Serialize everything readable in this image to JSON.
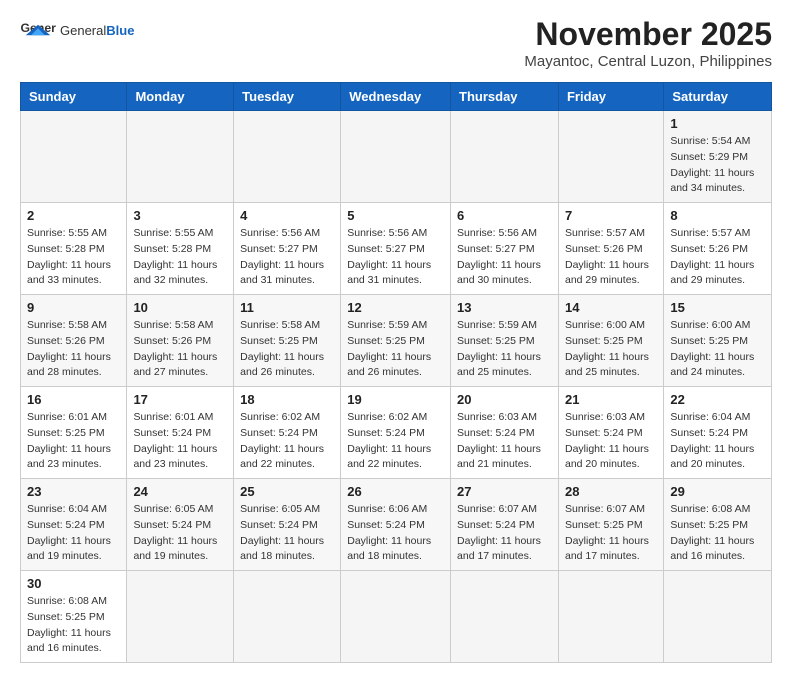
{
  "header": {
    "logo_general": "General",
    "logo_blue": "Blue",
    "month": "November 2025",
    "location": "Mayantoc, Central Luzon, Philippines"
  },
  "weekdays": [
    "Sunday",
    "Monday",
    "Tuesday",
    "Wednesday",
    "Thursday",
    "Friday",
    "Saturday"
  ],
  "rows": [
    [
      {
        "day": "",
        "info": ""
      },
      {
        "day": "",
        "info": ""
      },
      {
        "day": "",
        "info": ""
      },
      {
        "day": "",
        "info": ""
      },
      {
        "day": "",
        "info": ""
      },
      {
        "day": "",
        "info": ""
      },
      {
        "day": "1",
        "info": "Sunrise: 5:54 AM\nSunset: 5:29 PM\nDaylight: 11 hours and 34 minutes."
      }
    ],
    [
      {
        "day": "2",
        "info": "Sunrise: 5:55 AM\nSunset: 5:28 PM\nDaylight: 11 hours and 33 minutes."
      },
      {
        "day": "3",
        "info": "Sunrise: 5:55 AM\nSunset: 5:28 PM\nDaylight: 11 hours and 32 minutes."
      },
      {
        "day": "4",
        "info": "Sunrise: 5:56 AM\nSunset: 5:27 PM\nDaylight: 11 hours and 31 minutes."
      },
      {
        "day": "5",
        "info": "Sunrise: 5:56 AM\nSunset: 5:27 PM\nDaylight: 11 hours and 31 minutes."
      },
      {
        "day": "6",
        "info": "Sunrise: 5:56 AM\nSunset: 5:27 PM\nDaylight: 11 hours and 30 minutes."
      },
      {
        "day": "7",
        "info": "Sunrise: 5:57 AM\nSunset: 5:26 PM\nDaylight: 11 hours and 29 minutes."
      },
      {
        "day": "8",
        "info": "Sunrise: 5:57 AM\nSunset: 5:26 PM\nDaylight: 11 hours and 29 minutes."
      }
    ],
    [
      {
        "day": "9",
        "info": "Sunrise: 5:58 AM\nSunset: 5:26 PM\nDaylight: 11 hours and 28 minutes."
      },
      {
        "day": "10",
        "info": "Sunrise: 5:58 AM\nSunset: 5:26 PM\nDaylight: 11 hours and 27 minutes."
      },
      {
        "day": "11",
        "info": "Sunrise: 5:58 AM\nSunset: 5:25 PM\nDaylight: 11 hours and 26 minutes."
      },
      {
        "day": "12",
        "info": "Sunrise: 5:59 AM\nSunset: 5:25 PM\nDaylight: 11 hours and 26 minutes."
      },
      {
        "day": "13",
        "info": "Sunrise: 5:59 AM\nSunset: 5:25 PM\nDaylight: 11 hours and 25 minutes."
      },
      {
        "day": "14",
        "info": "Sunrise: 6:00 AM\nSunset: 5:25 PM\nDaylight: 11 hours and 25 minutes."
      },
      {
        "day": "15",
        "info": "Sunrise: 6:00 AM\nSunset: 5:25 PM\nDaylight: 11 hours and 24 minutes."
      }
    ],
    [
      {
        "day": "16",
        "info": "Sunrise: 6:01 AM\nSunset: 5:25 PM\nDaylight: 11 hours and 23 minutes."
      },
      {
        "day": "17",
        "info": "Sunrise: 6:01 AM\nSunset: 5:24 PM\nDaylight: 11 hours and 23 minutes."
      },
      {
        "day": "18",
        "info": "Sunrise: 6:02 AM\nSunset: 5:24 PM\nDaylight: 11 hours and 22 minutes."
      },
      {
        "day": "19",
        "info": "Sunrise: 6:02 AM\nSunset: 5:24 PM\nDaylight: 11 hours and 22 minutes."
      },
      {
        "day": "20",
        "info": "Sunrise: 6:03 AM\nSunset: 5:24 PM\nDaylight: 11 hours and 21 minutes."
      },
      {
        "day": "21",
        "info": "Sunrise: 6:03 AM\nSunset: 5:24 PM\nDaylight: 11 hours and 20 minutes."
      },
      {
        "day": "22",
        "info": "Sunrise: 6:04 AM\nSunset: 5:24 PM\nDaylight: 11 hours and 20 minutes."
      }
    ],
    [
      {
        "day": "23",
        "info": "Sunrise: 6:04 AM\nSunset: 5:24 PM\nDaylight: 11 hours and 19 minutes."
      },
      {
        "day": "24",
        "info": "Sunrise: 6:05 AM\nSunset: 5:24 PM\nDaylight: 11 hours and 19 minutes."
      },
      {
        "day": "25",
        "info": "Sunrise: 6:05 AM\nSunset: 5:24 PM\nDaylight: 11 hours and 18 minutes."
      },
      {
        "day": "26",
        "info": "Sunrise: 6:06 AM\nSunset: 5:24 PM\nDaylight: 11 hours and 18 minutes."
      },
      {
        "day": "27",
        "info": "Sunrise: 6:07 AM\nSunset: 5:24 PM\nDaylight: 11 hours and 17 minutes."
      },
      {
        "day": "28",
        "info": "Sunrise: 6:07 AM\nSunset: 5:25 PM\nDaylight: 11 hours and 17 minutes."
      },
      {
        "day": "29",
        "info": "Sunrise: 6:08 AM\nSunset: 5:25 PM\nDaylight: 11 hours and 16 minutes."
      }
    ],
    [
      {
        "day": "30",
        "info": "Sunrise: 6:08 AM\nSunset: 5:25 PM\nDaylight: 11 hours and 16 minutes."
      },
      {
        "day": "",
        "info": ""
      },
      {
        "day": "",
        "info": ""
      },
      {
        "day": "",
        "info": ""
      },
      {
        "day": "",
        "info": ""
      },
      {
        "day": "",
        "info": ""
      },
      {
        "day": "",
        "info": ""
      }
    ]
  ]
}
